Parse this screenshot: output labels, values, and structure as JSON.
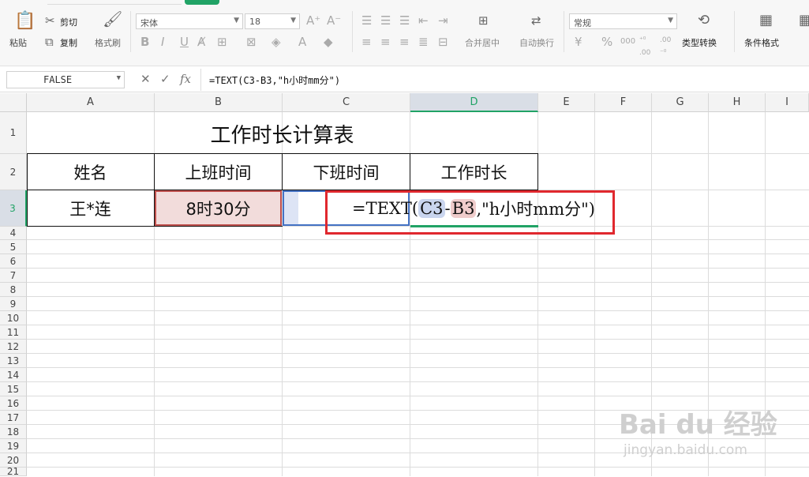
{
  "ribbon": {
    "cut": "剪切",
    "copy": "复制",
    "paste": "粘贴",
    "format_painter": "格式刷",
    "font_name": "宋体",
    "font_size": "18",
    "merge_center": "合并居中",
    "wrap_text": "自动换行",
    "number_format": "常规",
    "type_convert": "类型转换",
    "conditional_format": "条件格式",
    "bold": "B",
    "italic": "I",
    "underline": "U",
    "grow_font": "A⁺",
    "shrink_font": "A⁻",
    "currency": "¥",
    "percent": "%",
    "thousands": "000",
    "inc_decimal": "⁺⁰ .00",
    "dec_decimal": ".00 ⁻⁰"
  },
  "formula_bar": {
    "name_box": "FALSE",
    "fx": "fx",
    "formula": "=TEXT(C3-B3,\"h小时mm分\")"
  },
  "columns": [
    "A",
    "B",
    "C",
    "D",
    "E",
    "F",
    "G",
    "H",
    "I"
  ],
  "rows": [
    "1",
    "2",
    "3",
    "4",
    "5",
    "6",
    "7",
    "8",
    "9",
    "10",
    "11",
    "12",
    "13",
    "14",
    "15",
    "16",
    "17",
    "18",
    "19",
    "20",
    "21"
  ],
  "sheet": {
    "title": "工作时长计算表",
    "headers": [
      "姓名",
      "上班时间",
      "下班时间",
      "工作时长"
    ],
    "row3": {
      "name": "王*连",
      "start": "8时30分",
      "end": ""
    },
    "edit": {
      "prefix": "=TEXT(",
      "ref1": "C3",
      "minus": "-",
      "ref2": "B3",
      "suffix": ",\"h小时mm分\")"
    }
  },
  "watermark": {
    "brand": "Bai du 经验",
    "url": "jingyan.baidu.com"
  },
  "colors": {
    "accent_green": "#21a366",
    "highlight_red": "#e0282e",
    "ref_blue": "#c9d5ee",
    "ref_red": "#efcccb"
  }
}
